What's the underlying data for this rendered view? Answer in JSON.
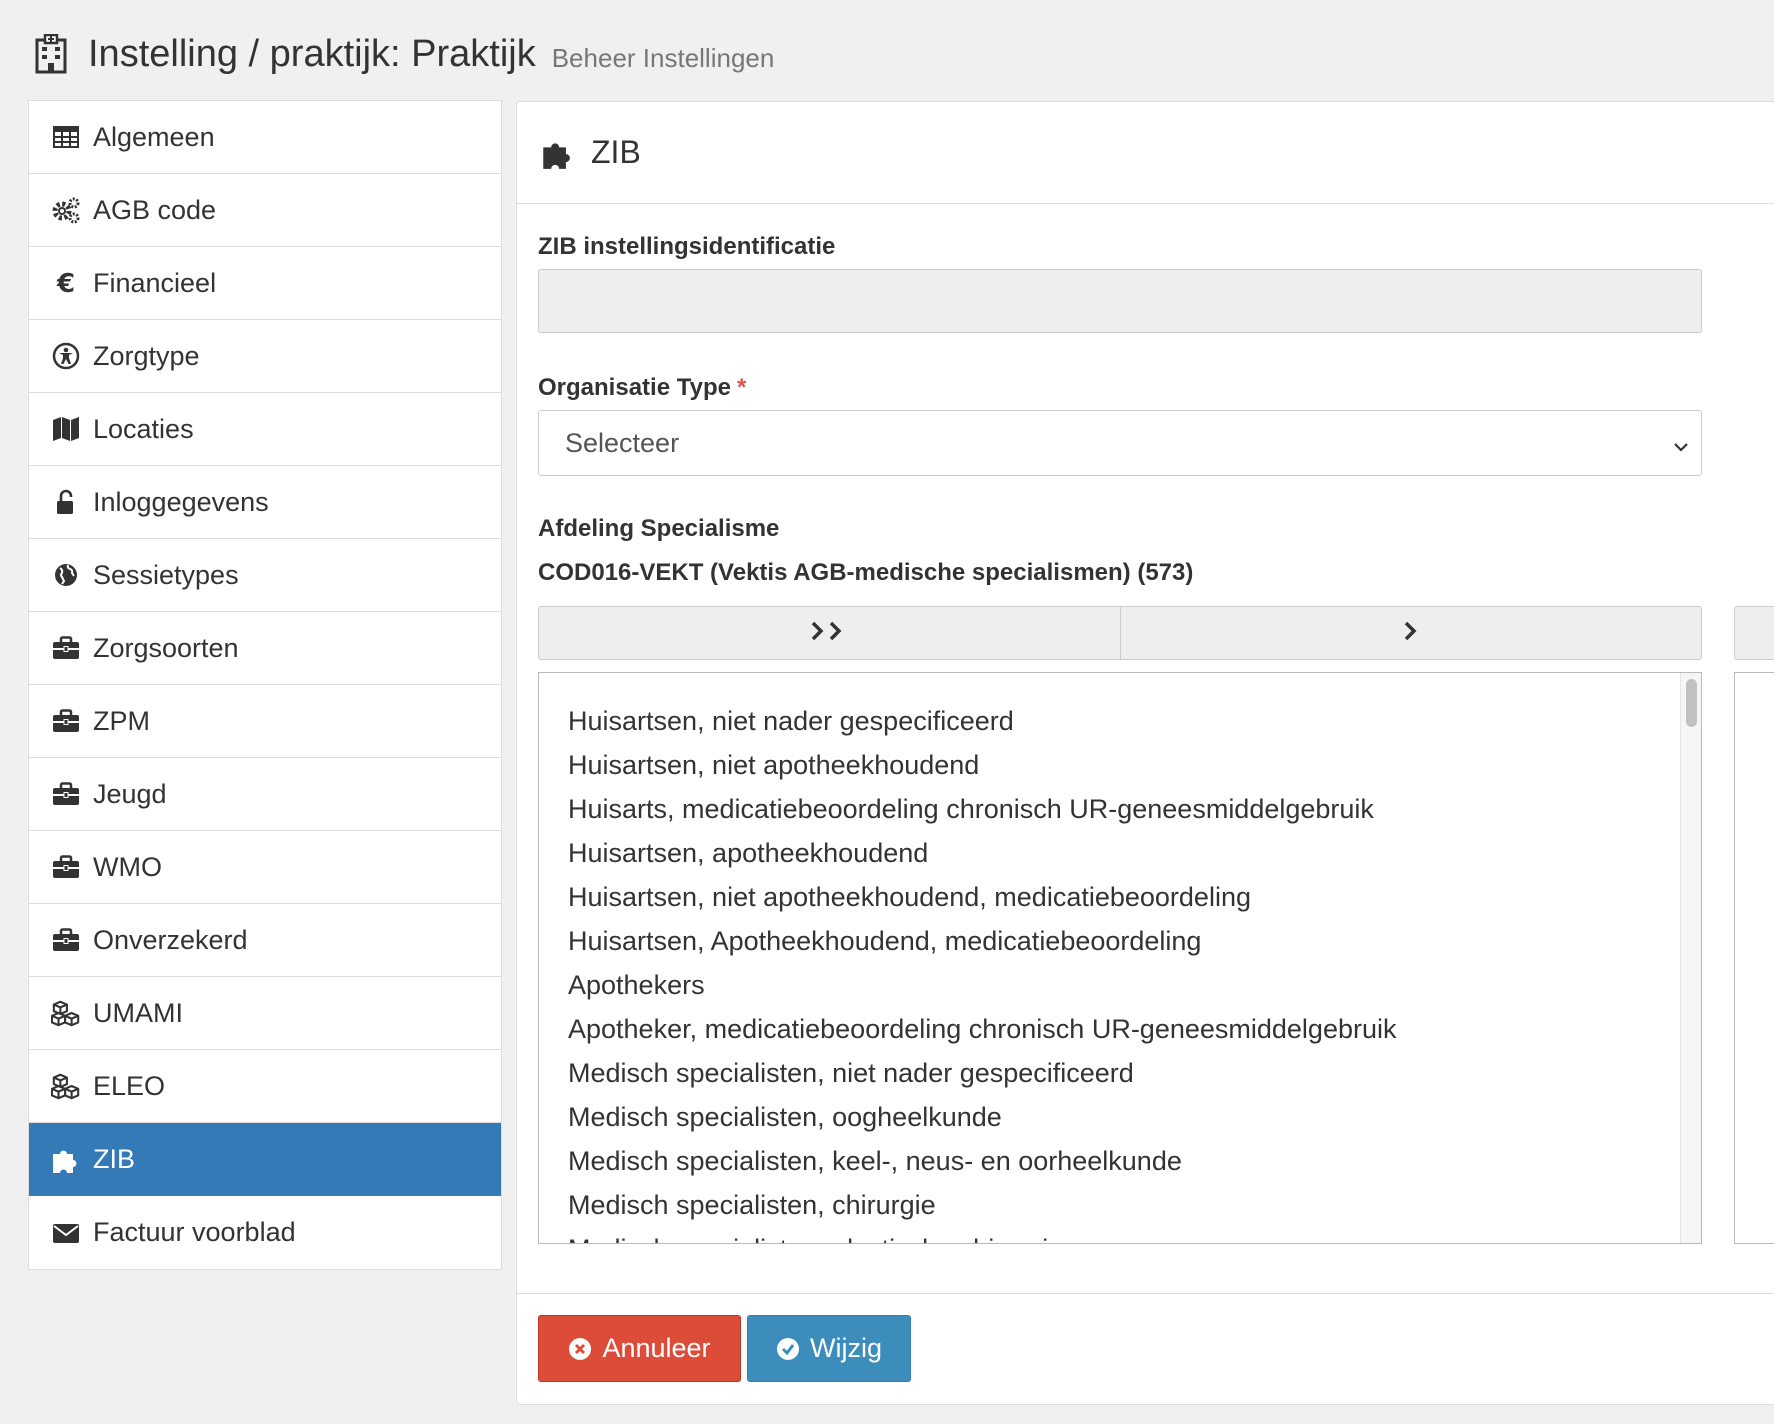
{
  "header": {
    "icon": "building-icon",
    "title": "Instelling / praktijk: Praktijk",
    "subtitle": "Beheer Instellingen"
  },
  "sidebar": {
    "items": [
      {
        "label": "Algemeen",
        "icon": "table-icon"
      },
      {
        "label": "AGB code",
        "icon": "cogs-icon"
      },
      {
        "label": "Financieel",
        "icon": "euro-icon"
      },
      {
        "label": "Zorgtype",
        "icon": "universal-access-icon"
      },
      {
        "label": "Locaties",
        "icon": "map-icon"
      },
      {
        "label": "Inloggegevens",
        "icon": "unlock-icon"
      },
      {
        "label": "Sessietypes",
        "icon": "globe-icon"
      },
      {
        "label": "Zorgsoorten",
        "icon": "briefcase-icon"
      },
      {
        "label": "ZPM",
        "icon": "briefcase-icon"
      },
      {
        "label": "Jeugd",
        "icon": "briefcase-icon"
      },
      {
        "label": "WMO",
        "icon": "briefcase-icon"
      },
      {
        "label": "Onverzekerd",
        "icon": "briefcase-icon"
      },
      {
        "label": "UMAMI",
        "icon": "cubes-icon"
      },
      {
        "label": "ELEO",
        "icon": "cubes-icon"
      },
      {
        "label": "ZIB",
        "icon": "puzzle-icon",
        "active": true
      },
      {
        "label": "Factuur voorblad",
        "icon": "envelope-icon"
      }
    ],
    "active_color": "#337ab7"
  },
  "panel": {
    "title": "ZIB",
    "icon": "puzzle-icon",
    "fields": {
      "zib_id_label": "ZIB instellingsidentificatie",
      "zib_id_value": "",
      "org_type_label": "Organisatie Type",
      "org_type_required": "*",
      "org_type_value": "Selecteer",
      "afdeling_label": "Afdeling Specialisme",
      "codelist_label": "COD016-VEKT (Vektis AGB-medische specialismen) (573)"
    },
    "dual_list": {
      "move_all_icon": "double-chevron-right-icon",
      "move_one_icon": "chevron-right-icon",
      "options": [
        "Huisartsen, niet nader gespecificeerd",
        "Huisartsen, niet apotheekhoudend",
        "Huisarts, medicatiebeoordeling chronisch UR-geneesmiddelgebruik",
        "Huisartsen, apotheekhoudend",
        "Huisartsen, niet apotheekhoudend, medicatiebeoordeling",
        "Huisartsen, Apotheekhoudend, medicatiebeoordeling",
        "Apothekers",
        "Apotheker, medicatiebeoordeling chronisch UR-geneesmiddelgebruik",
        "Medisch specialisten, niet nader gespecificeerd",
        "Medisch specialisten, oogheelkunde",
        "Medisch specialisten, keel-, neus- en oorheelkunde",
        "Medisch specialisten, chirurgie",
        "Medisch specialisten, plastische chirurgie"
      ]
    },
    "buttons": {
      "cancel_label": "Annuleer",
      "save_label": "Wijzig",
      "cancel_color": "#dd4b39",
      "save_color": "#3c8dbc"
    }
  }
}
